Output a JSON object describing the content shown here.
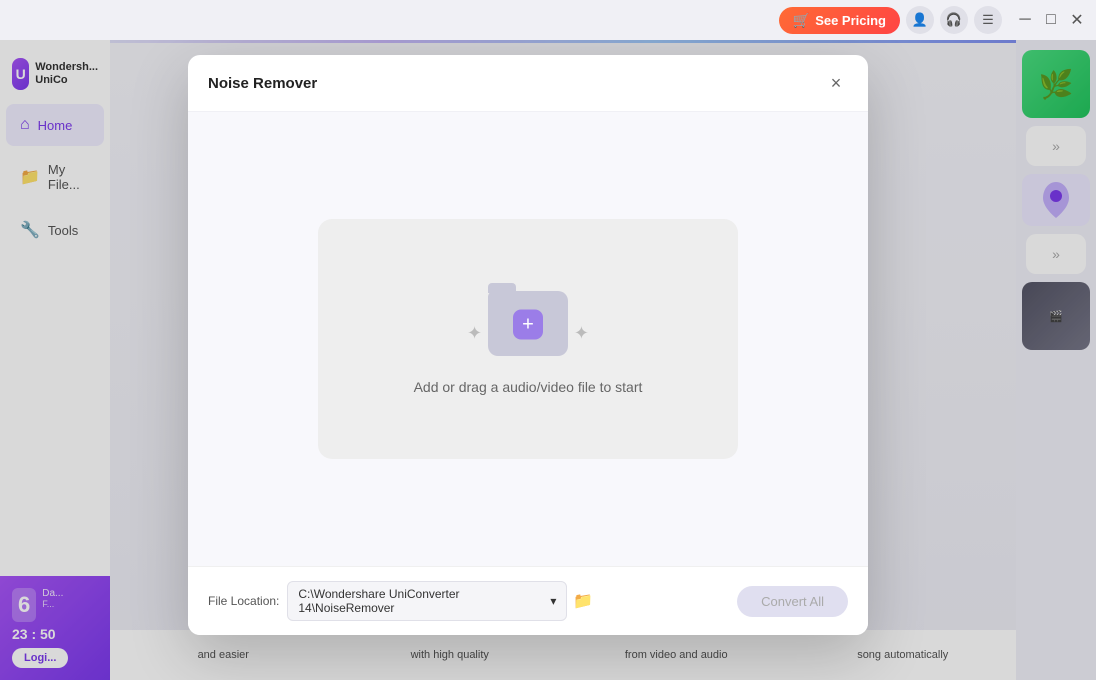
{
  "titleBar": {
    "seePricing": "See Pricing",
    "cartIcon": "🛒"
  },
  "windowControls": {
    "minimize": "─",
    "maximize": "□",
    "close": "✕"
  },
  "sidebar": {
    "logoText1": "Wondersh...",
    "logoText2": "UniCo",
    "items": [
      {
        "id": "home",
        "label": "Home",
        "icon": "⌂",
        "active": true
      },
      {
        "id": "myfiles",
        "label": "My File...",
        "icon": "📁",
        "active": false
      },
      {
        "id": "tools",
        "label": "Tools",
        "icon": "🔧",
        "active": false
      }
    ],
    "promo": {
      "dayNumber": "6",
      "dayLabel": "Da...",
      "subLabel": "F...",
      "countdown": "23 : 50",
      "loginBtn": "Logi..."
    }
  },
  "modal": {
    "title": "Noise Remover",
    "closeBtn": "×",
    "dropZone": {
      "text": "Add or drag a audio/video file to start",
      "plusIcon": "+"
    },
    "footer": {
      "fileLocationLabel": "File Location:",
      "fileLocationValue": "C:\\Wondershare UniConverter 14\\NoiseRemover",
      "dropdownArrow": "▾",
      "convertAllBtn": "Convert All"
    }
  },
  "featuresBar": {
    "items": [
      "and easier",
      "with high quality",
      "from video and audio",
      "song automatically"
    ]
  },
  "rightPanel": {
    "arrowIcon": "»"
  }
}
